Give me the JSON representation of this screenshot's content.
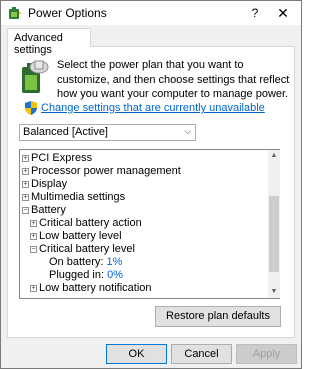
{
  "window": {
    "title": "Power Options",
    "help_label": "?",
    "close_label": "✕"
  },
  "tabs": [
    {
      "label": "Advanced settings"
    }
  ],
  "description": "Select the power plan that you want to customize, and then choose settings that reflect how you want your computer to manage power.",
  "change_link": "Change settings that are currently unavailable",
  "plan_select": {
    "value": "Balanced [Active]"
  },
  "tree": {
    "items": [
      {
        "expander": "+",
        "label": "PCI Express"
      },
      {
        "expander": "+",
        "label": "Processor power management"
      },
      {
        "expander": "+",
        "label": "Display"
      },
      {
        "expander": "+",
        "label": "Multimedia settings"
      },
      {
        "expander": "−",
        "label": "Battery"
      },
      {
        "expander": "+",
        "label": "Critical battery action"
      },
      {
        "expander": "+",
        "label": "Low battery level"
      },
      {
        "expander": "−",
        "label": "Critical battery level"
      },
      {
        "label": "On battery:",
        "value": "1%"
      },
      {
        "label": "Plugged in:",
        "value": "0%"
      },
      {
        "expander": "+",
        "label": "Low battery notification"
      }
    ]
  },
  "buttons": {
    "restore": "Restore plan defaults",
    "ok": "OK",
    "cancel": "Cancel",
    "apply": "Apply"
  },
  "colors": {
    "link": "#0066cc",
    "value": "#0066cc",
    "focus_border": "#0078d7"
  },
  "icons": [
    "power-options-icon",
    "battery-plan-icon",
    "uac-shield-icon",
    "chevron-down-icon",
    "scroll-up-icon",
    "scroll-down-icon"
  ]
}
